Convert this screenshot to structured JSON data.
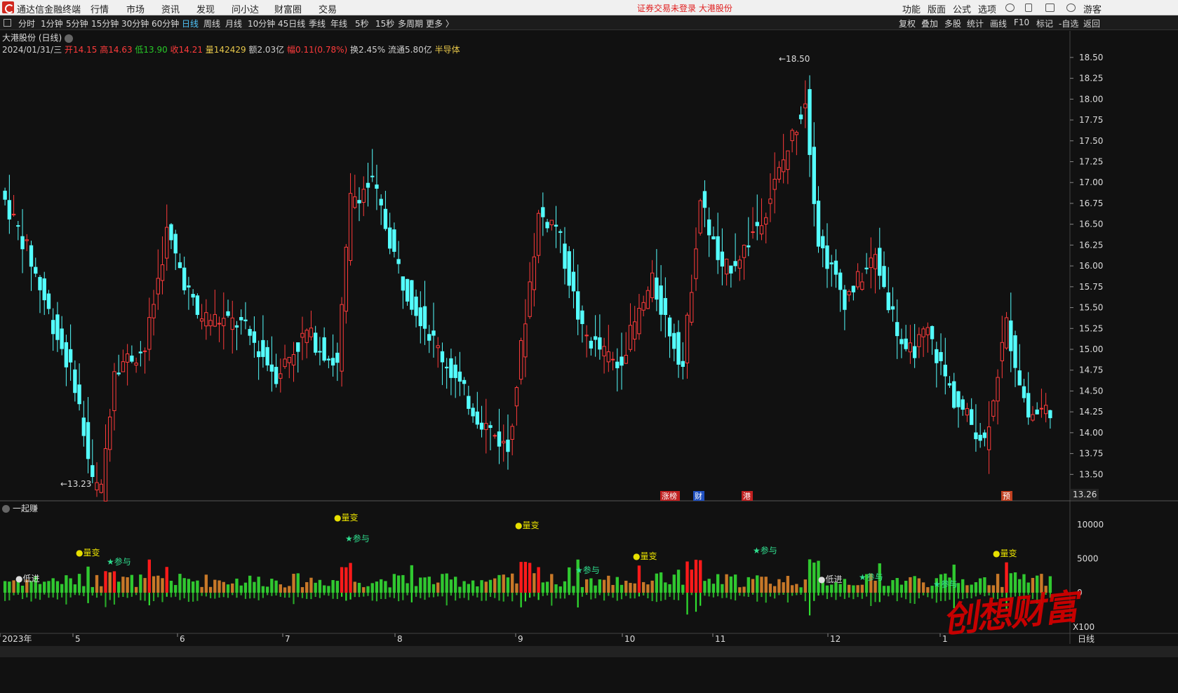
{
  "app": {
    "title": "通达信金融终端",
    "notice": "证券交易未登录 大港股份",
    "user": "游客"
  },
  "menu": [
    "行情",
    "市场",
    "资讯",
    "发现",
    "问小达",
    "财富圈",
    "交易"
  ],
  "right_menu": [
    "功能",
    "版面",
    "公式",
    "选项"
  ],
  "timeframes": [
    "分时",
    "1分钟",
    "5分钟",
    "15分钟",
    "30分钟",
    "60分钟",
    "日线",
    "周线",
    "月线",
    "10分钟",
    "45日线",
    "季线",
    "年线",
    "5秒",
    "15秒",
    "多周期",
    "更多 〉"
  ],
  "active_timeframe": "日线",
  "right_tools": [
    "复权",
    "叠加",
    "多股",
    "统计",
    "画线",
    "F10",
    "标记",
    "-自选",
    "返回"
  ],
  "stock": {
    "name_line": "大港股份 (日线)",
    "date": "2024/01/31/三",
    "open": "开14.15",
    "high": "高14.63",
    "low": "低13.90",
    "close": "收14.21",
    "volume": "量142429",
    "amount": "额2.03亿",
    "change": "幅0.11(0.78%)",
    "turnover": "换2.45%",
    "float": "流通5.80亿",
    "sector": "半导体"
  },
  "price_axis": {
    "ticks": [
      "18.50",
      "18.25",
      "18.00",
      "17.75",
      "17.50",
      "17.25",
      "17.00",
      "16.75",
      "16.50",
      "16.25",
      "16.00",
      "15.75",
      "15.50",
      "15.25",
      "15.00",
      "14.75",
      "14.50",
      "14.25",
      "14.00",
      "13.75",
      "13.50"
    ],
    "current": "13.26",
    "max_label": "18.50",
    "min_label": "13.23"
  },
  "events": [
    "涨榜",
    "财",
    "港",
    "预"
  ],
  "indicator": {
    "name": "一起赚",
    "ticks": [
      "10000",
      "5000",
      "0",
      "X100"
    ],
    "signals": [
      "量变",
      "参与",
      "低进"
    ]
  },
  "x_axis": {
    "labels": [
      "2023年",
      "5",
      "6",
      "7",
      "8",
      "9",
      "10",
      "11",
      "12",
      "1"
    ],
    "period": "日线"
  },
  "colors": {
    "up": "#ff3b3b",
    "down": "#54ffff",
    "vol_up": "#ff1a1a",
    "vol_down": "#40e040"
  },
  "watermark": "创想财富"
}
